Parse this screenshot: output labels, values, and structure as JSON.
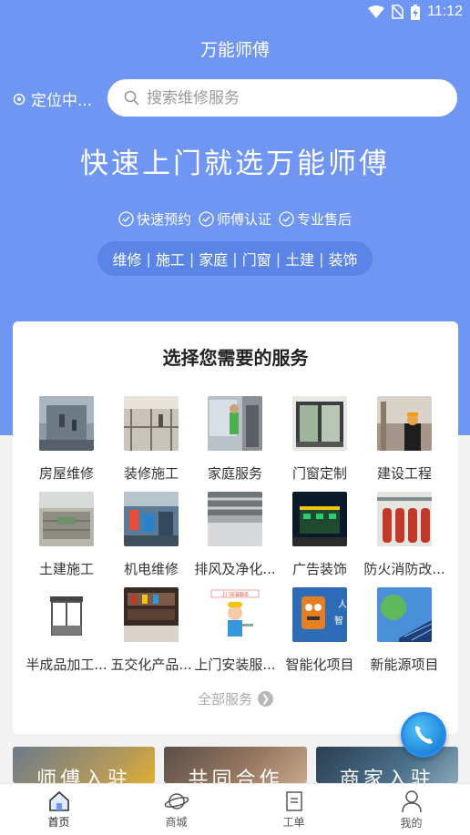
{
  "status": {
    "time": "11:12"
  },
  "header": {
    "title": "万能师傅"
  },
  "location": {
    "label": "定位中..."
  },
  "search": {
    "placeholder": "搜索维修服务"
  },
  "hero": {
    "slogan": "快速上门就选万能师傅",
    "features": [
      "快速预约",
      "师傅认证",
      "专业售后"
    ],
    "tags": [
      "维修",
      "施工",
      "家庭",
      "门窗",
      "土建",
      "装饰"
    ]
  },
  "services": {
    "title": "选择您需要的服务",
    "items": [
      {
        "label": "房屋维修"
      },
      {
        "label": "装修施工"
      },
      {
        "label": "家庭服务"
      },
      {
        "label": "门窗定制"
      },
      {
        "label": "建设工程"
      },
      {
        "label": "土建施工"
      },
      {
        "label": "机电维修"
      },
      {
        "label": "排风及净化..."
      },
      {
        "label": "广告装饰"
      },
      {
        "label": "防火消防改..."
      },
      {
        "label": "半成品加工..."
      },
      {
        "label": "五交化产品..."
      },
      {
        "label": "上门安装服..."
      },
      {
        "label": "智能化项目"
      },
      {
        "label": "新能源项目"
      }
    ],
    "all_label": "全部服务"
  },
  "banners": [
    {
      "label": "师傅入驻"
    },
    {
      "label": "共同合作"
    },
    {
      "label": "商家入驻"
    }
  ],
  "thumb_badge": "上门安装服务",
  "tabs": [
    {
      "label": "首页",
      "icon": "home-icon"
    },
    {
      "label": "商城",
      "icon": "planet-icon"
    },
    {
      "label": "工单",
      "icon": "document-icon"
    },
    {
      "label": "我的",
      "icon": "user-icon"
    }
  ],
  "colors": {
    "brand": "#6f96f3",
    "pill": "#5a84e6",
    "fab": "#0d6fd1"
  }
}
